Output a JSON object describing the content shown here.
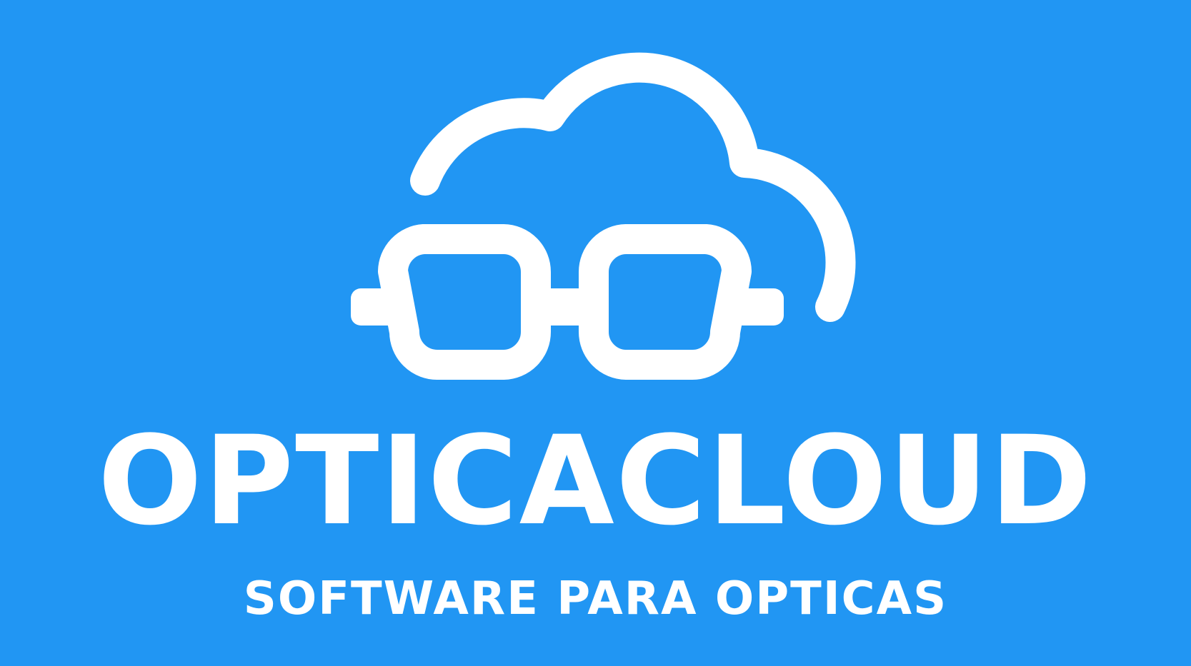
{
  "brand": {
    "name": "OPTICACLOUD",
    "tagline": "SOFTWARE PARA OPTICAS"
  },
  "colors": {
    "background": "#2196F3",
    "foreground": "#FFFFFF"
  },
  "icons": {
    "logo": "cloud-glasses-icon"
  }
}
